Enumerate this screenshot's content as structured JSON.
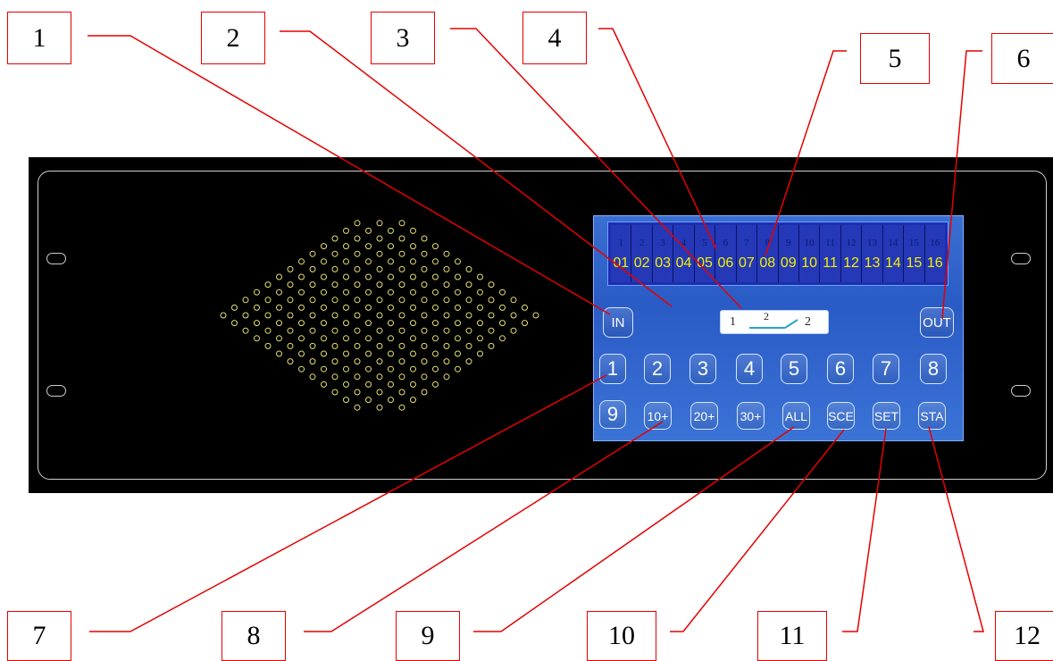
{
  "callouts": [
    "1",
    "2",
    "3",
    "4",
    "5",
    "6",
    "7",
    "8",
    "9",
    "10",
    "11",
    "12"
  ],
  "screen": {
    "channel_numbers": [
      "1",
      "2",
      "3",
      "4",
      "5",
      "6",
      "7",
      "8",
      "9",
      "10",
      "11",
      "12",
      "13",
      "14",
      "15",
      "16"
    ],
    "channel_labels": [
      "01",
      "02",
      "03",
      "04",
      "05",
      "06",
      "07",
      "08",
      "09",
      "10",
      "11",
      "12",
      "13",
      "14",
      "15",
      "16"
    ],
    "in_label": "IN",
    "out_label": "OUT",
    "route_in": "1",
    "route_mid": "2",
    "route_out": "2",
    "row1": [
      "1",
      "2",
      "3",
      "4",
      "5",
      "6",
      "7",
      "8"
    ],
    "row2": [
      "9",
      "10+",
      "20+",
      "30+",
      "ALL",
      "SCE",
      "SET",
      "STA"
    ]
  },
  "colors": {
    "callout_line": "#e60000",
    "chassis": "#000000",
    "screen": "#2a5bc6",
    "channel_text": "#f4f000"
  }
}
